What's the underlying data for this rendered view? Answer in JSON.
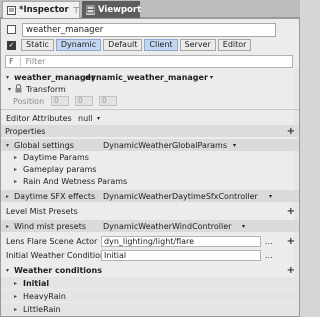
{
  "tabs": {
    "inspector": {
      "label": "*Inspector",
      "pin": "⊤",
      "close": "×"
    },
    "viewport": {
      "label": "Viewport"
    }
  },
  "object": {
    "name_value": "weather_manager",
    "flags": [
      {
        "label": "Static",
        "active": false
      },
      {
        "label": "Dynamic",
        "active": true
      },
      {
        "label": "Default",
        "active": false
      },
      {
        "label": "Client",
        "active": true
      },
      {
        "label": "Server",
        "active": false
      },
      {
        "label": "Editor",
        "active": false
      }
    ]
  },
  "filter": {
    "icon": "F",
    "placeholder": "Filter"
  },
  "entity": {
    "name": "weather_manager",
    "type": "dynamic_weather_manager"
  },
  "transform": {
    "label": "Transform",
    "position_label": "Position",
    "position": [
      "0",
      "0",
      "0"
    ]
  },
  "editor_attributes": {
    "label": "Editor Attributes",
    "value": "null"
  },
  "properties": {
    "header": "Properties",
    "global_settings": {
      "label": "Global settings",
      "value": "DynamicWeatherGlobalParams"
    },
    "daytime_params": "Daytime Params",
    "gameplay_params": "Gameplay params",
    "rain_wetness": "Rain And Wetness Params",
    "daytime_sfx": {
      "label": "Daytime SFX effects",
      "value": "DynamicWeatherDaytimeSfxController"
    },
    "level_mist": "Level Mist Presets",
    "wind_mist": {
      "label": "Wind mist presets",
      "value": "DynamicWeatherWindController"
    },
    "lens_flare": {
      "label": "Lens Flare Scene Actor",
      "value": "dyn_lighting/light/flare"
    },
    "initial_condition": {
      "label": "Initial Weather Condition",
      "value": "Initial"
    },
    "weather_conditions": "Weather conditions",
    "conditions": [
      "Initial",
      "HeavyRain",
      "LittleRain"
    ]
  },
  "glyphs": {
    "plus": "+",
    "ellipsis": "...",
    "caret_down": "▾",
    "caret_right": "▸",
    "check": "✓"
  }
}
